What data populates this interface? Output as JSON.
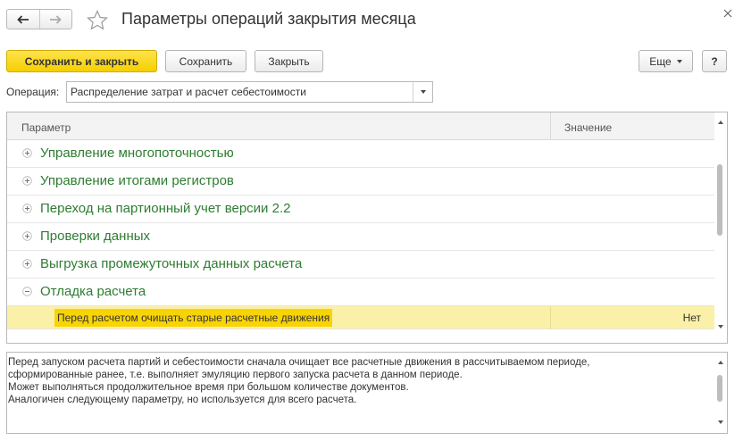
{
  "window": {
    "title": "Параметры операций закрытия месяца"
  },
  "toolbar": {
    "save_close_label": "Сохранить и закрыть",
    "save_label": "Сохранить",
    "close_label": "Закрыть",
    "more_label": "Еще",
    "help_label": "?"
  },
  "operation": {
    "label": "Операция:",
    "value": "Распределение затрат и расчет себестоимости"
  },
  "table": {
    "columns": [
      "Параметр",
      "Значение"
    ],
    "groups": [
      {
        "label": "Управление многопоточностью",
        "expanded": false
      },
      {
        "label": "Управление итогами регистров",
        "expanded": false
      },
      {
        "label": "Переход на партионный учет версии 2.2",
        "expanded": false
      },
      {
        "label": "Проверки данных",
        "expanded": false
      },
      {
        "label": "Выгрузка промежуточных данных расчета",
        "expanded": false
      },
      {
        "label": "Отладка расчета",
        "expanded": true
      }
    ],
    "selected_row": {
      "label": "Перед расчетом очищать старые расчетные движения",
      "value": "Нет"
    }
  },
  "description": {
    "lines": [
      "Перед запуском расчета партий и себестоимости сначала очищает все расчетные движения в рассчитываемом периоде,",
      "сформированные ранее, т.е. выполняет эмуляцию первого запуска расчета в данном периоде.",
      "Может выполняться продолжительное время при большом количестве документов.",
      "Аналогичен следующему параметру, но используется для всего расчета."
    ]
  },
  "colors": {
    "primary_button": "#f6cf00",
    "group_text": "#2e7d32",
    "selected_row": "#fbf0a8",
    "selected_cell": "#f9d405"
  }
}
